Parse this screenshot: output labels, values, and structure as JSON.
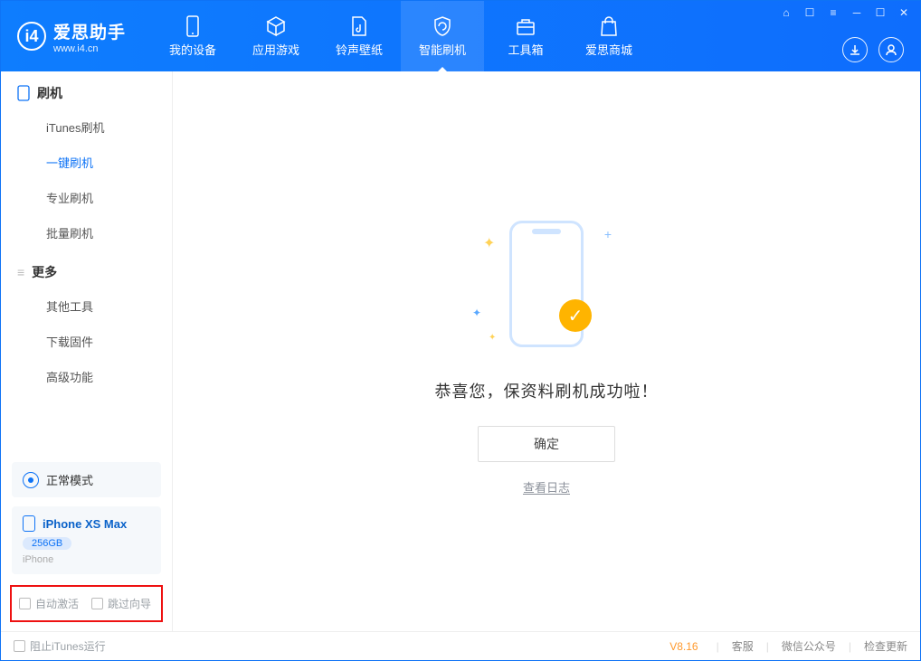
{
  "brand": {
    "name": "爱思助手",
    "site": "www.i4.cn"
  },
  "nav": [
    {
      "label": "我的设备"
    },
    {
      "label": "应用游戏"
    },
    {
      "label": "铃声壁纸"
    },
    {
      "label": "智能刷机"
    },
    {
      "label": "工具箱"
    },
    {
      "label": "爱思商城"
    }
  ],
  "sidebar": {
    "group1_title": "刷机",
    "items1": [
      "iTunes刷机",
      "一键刷机",
      "专业刷机",
      "批量刷机"
    ],
    "group2_title": "更多",
    "items2": [
      "其他工具",
      "下载固件",
      "高级功能"
    ]
  },
  "device": {
    "mode": "正常模式",
    "name": "iPhone XS Max",
    "capacity": "256GB",
    "type": "iPhone"
  },
  "options": {
    "auto_activate": "自动激活",
    "skip_wizard": "跳过向导"
  },
  "main": {
    "success_text": "恭喜您，保资料刷机成功啦！",
    "ok_button": "确定",
    "view_log": "查看日志"
  },
  "footer": {
    "block_itunes": "阻止iTunes运行",
    "version": "V8.16",
    "links": [
      "客服",
      "微信公众号",
      "检查更新"
    ]
  }
}
